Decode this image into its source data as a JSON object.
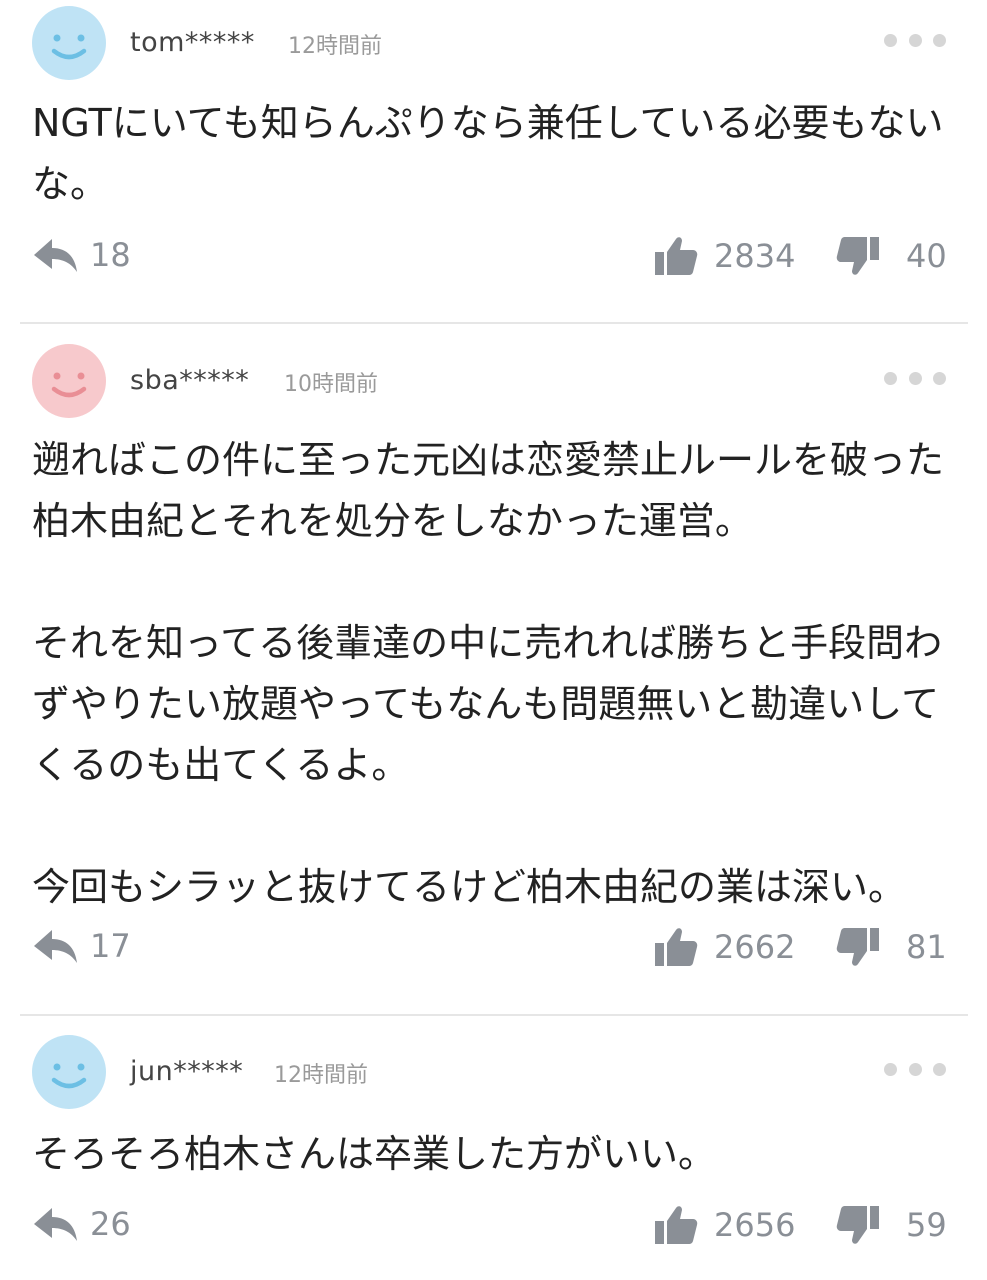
{
  "comments": [
    {
      "username": "tom*****",
      "time": "12時間前",
      "avatar_color": "#bfe3f5",
      "avatar_face": "#6cbfe4",
      "text": "NGTにいても知らんぷりなら兼任している必要もないな。",
      "replies": "18",
      "likes": "2834",
      "dislikes": "40"
    },
    {
      "username": "sba*****",
      "time": "10時間前",
      "avatar_color": "#f7c9cc",
      "avatar_face": "#e98e95",
      "text": "遡ればこの件に至った元凶は恋愛禁止ルールを破った柏木由紀とそれを処分をしなかった運営。\n\nそれを知ってる後輩達の中に売れれば勝ちと手段問わずやりたい放題やってもなんも問題無いと勘違いしてくるのも出てくるよ。\n\n今回もシラッと抜けてるけど柏木由紀の業は深い。",
      "replies": "17",
      "likes": "2662",
      "dislikes": "81"
    },
    {
      "username": "jun*****",
      "time": "12時間前",
      "avatar_color": "#bfe3f5",
      "avatar_face": "#6cbfe4",
      "text": "そろそろ柏木さんは卒業した方がいい。",
      "replies": "26",
      "likes": "2656",
      "dislikes": "59"
    }
  ],
  "icons": {
    "reply": "reply-arrow-icon",
    "like": "thumbs-up-icon",
    "dislike": "thumbs-down-icon",
    "more": "more-dots-icon"
  },
  "colors": {
    "icon_gray": "#8a8f96",
    "divider": "#e6e6e6"
  }
}
